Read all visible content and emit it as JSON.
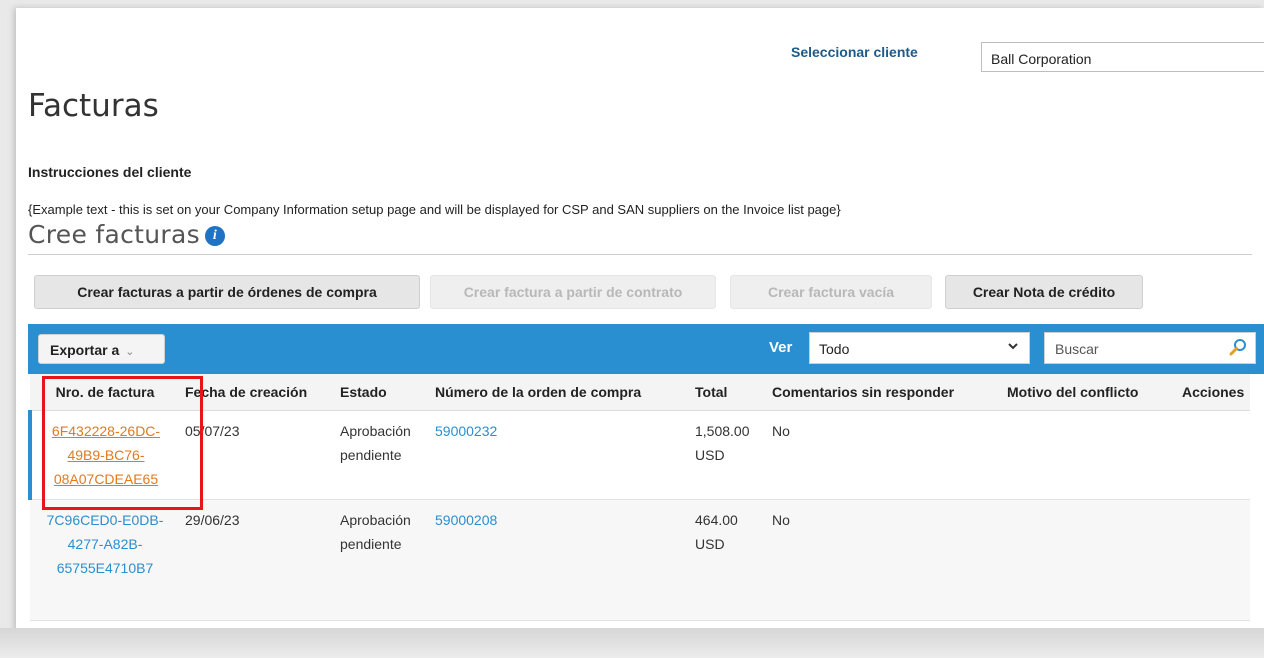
{
  "client": {
    "label": "Seleccionar cliente",
    "selected": "Ball Corporation"
  },
  "page_title": "Facturas",
  "instructions": {
    "heading": "Instrucciones del cliente",
    "text": "{Example text - this is set on your Company Information setup page and will be displayed for CSP and SAN suppliers on the Invoice list page}"
  },
  "create": {
    "title": "Cree facturas",
    "info_icon": "info-icon",
    "buttons": [
      {
        "label": "Crear facturas a partir de órdenes de compra",
        "enabled": true
      },
      {
        "label": "Crear factura a partir de contrato",
        "enabled": false
      },
      {
        "label": "Crear factura vacía",
        "enabled": false
      },
      {
        "label": "Crear Nota de crédito",
        "enabled": true
      }
    ]
  },
  "toolbar": {
    "export_label": "Exportar a",
    "view_label": "Ver",
    "view_value": "Todo",
    "search_placeholder": "Buscar"
  },
  "table": {
    "columns": [
      "Nro. de factura",
      "Fecha de creación",
      "Estado",
      "Número de la orden de compra",
      "Total",
      "Comentarios sin responder",
      "Motivo del conflicto",
      "Acciones"
    ],
    "rows": [
      {
        "invoice": "6F432228-26DC-49B9-BC76-08A07CDEAE65",
        "date": "05/07/23",
        "status": "Aprobación pendiente",
        "po": "59000232",
        "total": "1,508.00 USD",
        "comments": "No",
        "dispute": "",
        "actions": ""
      },
      {
        "invoice": "7C96CED0-E0DB-4277-A82B-65755E4710B7",
        "date": "29/06/23",
        "status": "Aprobación pendiente",
        "po": "59000208",
        "total": "464.00 USD",
        "comments": "No",
        "dispute": "",
        "actions": ""
      }
    ]
  },
  "colors": {
    "toolbar_blue": "#2a8fd0",
    "link_blue": "#2a8fd0",
    "selected_link_orange": "#e07a1d",
    "highlight_red": "#e8141c"
  }
}
